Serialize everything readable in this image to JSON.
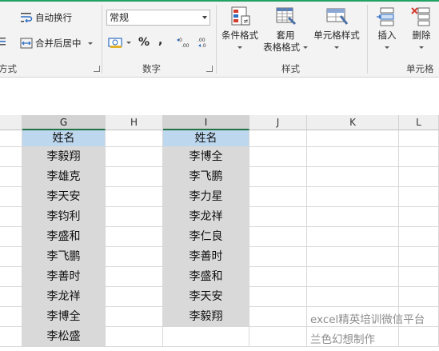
{
  "ribbon": {
    "wrap_text": "自动换行",
    "merge_center": "合并后居中",
    "alignment_group_partial": "方式",
    "number_format": "常规",
    "percent_symbol": "%",
    "comma_symbol": ",",
    "number_group": "数字",
    "conditional_format": "条件格式",
    "table_format_line1": "套用",
    "table_format_line2": "表格格式",
    "cell_styles": "单元格样式",
    "styles_group": "样式",
    "insert": "插入",
    "delete": "删除",
    "cells_group_partial": "单元格"
  },
  "columns": [
    "G",
    "H",
    "I",
    "J",
    "K",
    "L"
  ],
  "header_label": "姓名",
  "col_g": [
    "李毅翔",
    "李雄克",
    "李天安",
    "李钧利",
    "李盛和",
    "李飞鹏",
    "李善时",
    "李龙祥",
    "李博全",
    "李松盛"
  ],
  "col_i": [
    "李博全",
    "李飞鹏",
    "李力星",
    "李龙祥",
    "李仁良",
    "李善时",
    "李盛和",
    "李天安",
    "李毅翔"
  ],
  "notes": [
    "excel精英培训微信平台",
    "兰色幻想制作"
  ],
  "colors": {
    "accent": "#217346",
    "header_fill": "#bdd7ee",
    "gray_fill": "#d9d9d9"
  }
}
